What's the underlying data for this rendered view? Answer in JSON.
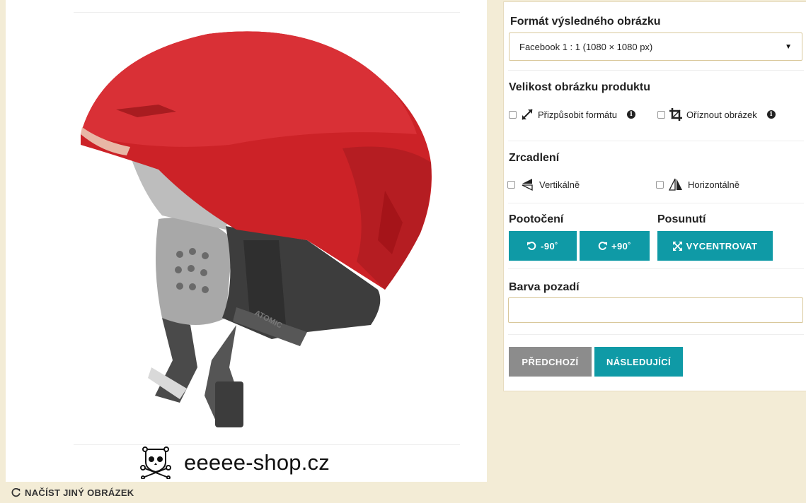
{
  "preview": {
    "brand_text": "eeeee-shop.cz",
    "logo_icon": "skull-crossbones-icon",
    "helmet_brand": "ATOMIC"
  },
  "reload_label": "NAČÍST JINÝ OBRÁZEK",
  "panel": {
    "format": {
      "title": "Formát výsledného obrázku",
      "selected": "Facebook 1 : 1 (1080 × 1080 px)"
    },
    "size": {
      "title": "Velikost obrázku produktu",
      "fit_label": "Přizpůsobit formátu",
      "crop_label": "Oříznout obrázek"
    },
    "mirror": {
      "title": "Zrcadlení",
      "vertical_label": "Vertikálně",
      "horizontal_label": "Horizontálně"
    },
    "rotate": {
      "title": "Pootočení",
      "left_label": "-90˚",
      "right_label": "+90˚"
    },
    "shift": {
      "title": "Posunutí",
      "center_label": "VYCENTROVAT"
    },
    "background": {
      "title": "Barva pozadí",
      "value": ""
    },
    "nav": {
      "prev_label": "PŘEDCHOZÍ",
      "next_label": "NÁSLEDUJÍCÍ"
    }
  },
  "colors": {
    "accent": "#0f9aa6",
    "secondary": "#8c8c8c",
    "page_bg": "#f3ecd6"
  }
}
